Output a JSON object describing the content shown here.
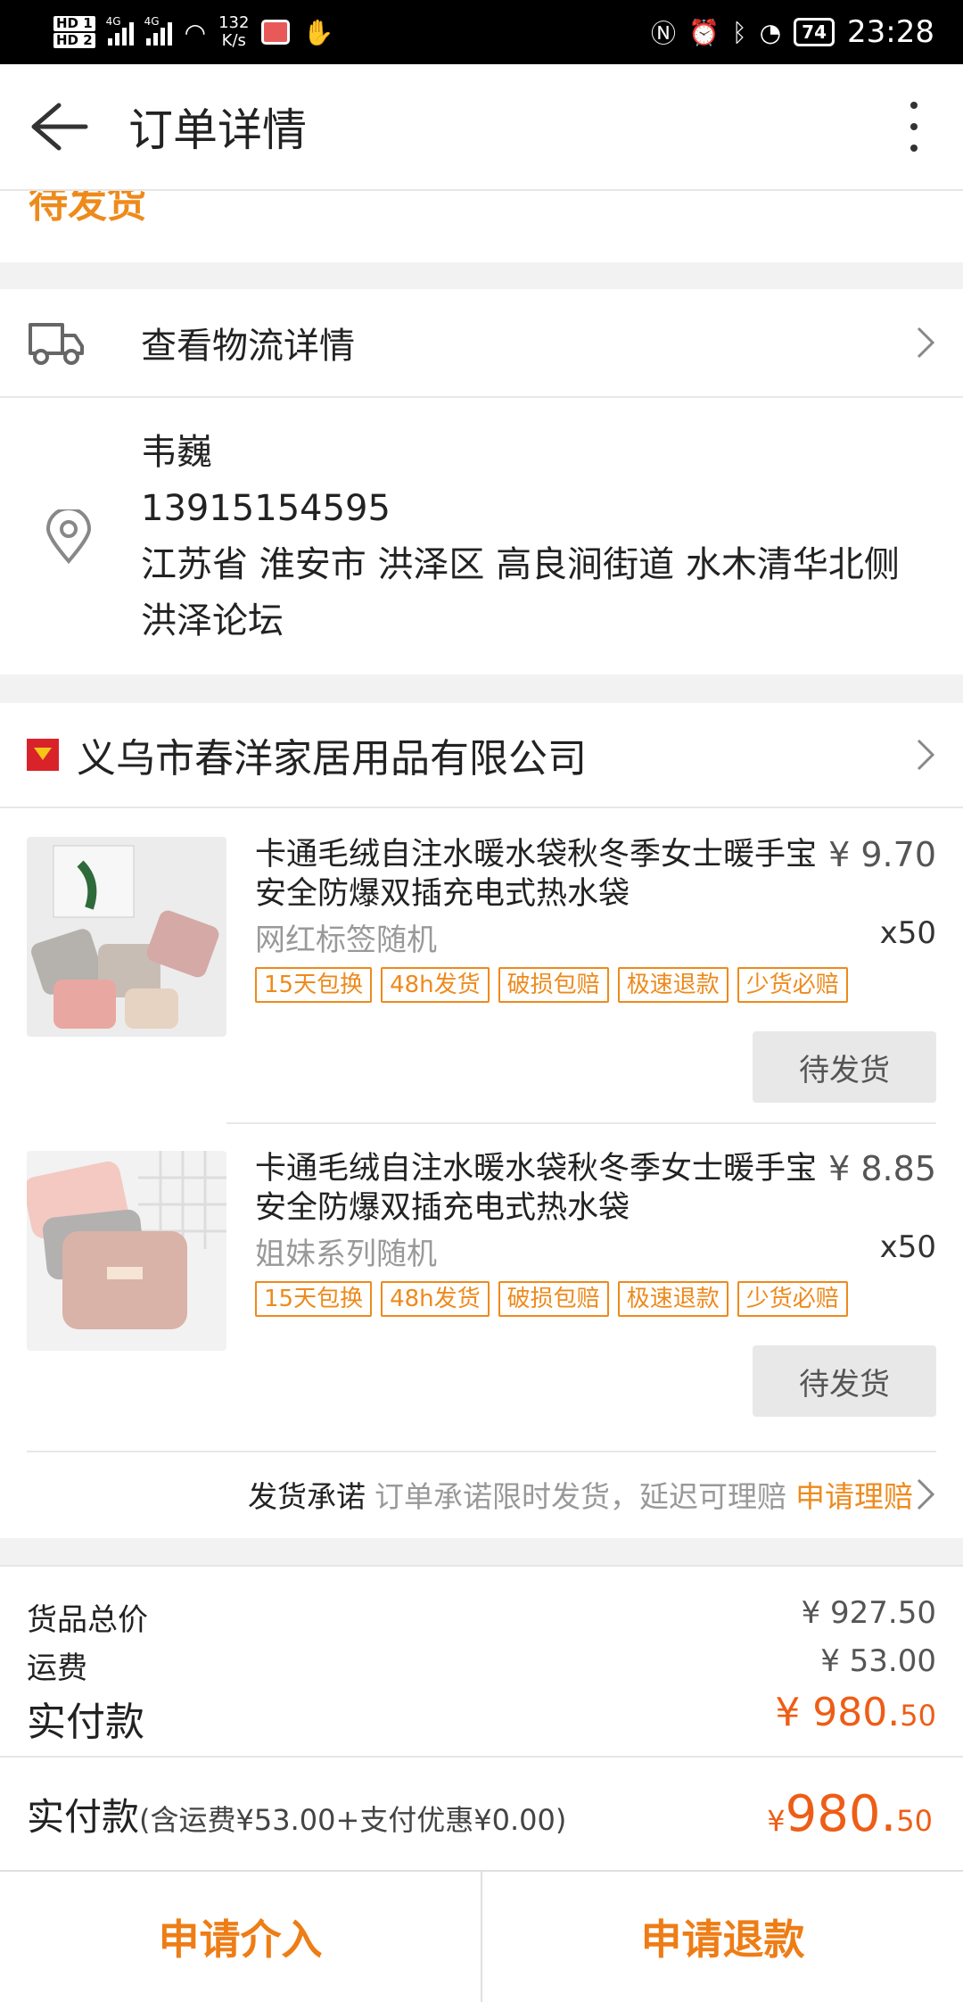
{
  "status_bar": {
    "hd1": "HD 1",
    "hd2": "HD 2",
    "net1": "4G",
    "net2": "4G",
    "speed_value": "132",
    "speed_unit": "K/s",
    "battery": "74",
    "time": "23:28"
  },
  "header": {
    "title": "订单详情"
  },
  "order_status": "待发货",
  "logistics": {
    "label": "查看物流详情"
  },
  "address": {
    "name": "韦巍",
    "phone": "13915154595",
    "line1": "江苏省 淮安市 洪泽区 高良涧街道 水木清华北侧",
    "line2": "洪泽论坛"
  },
  "shop": {
    "name": "义乌市春洋家居用品有限公司"
  },
  "items": [
    {
      "title": "卡通毛绒自注水暖水袋秋冬季女士暖手宝安全防爆双插充电式热水袋",
      "price": "¥ 9.70",
      "spec": "网红标签随机",
      "qty": "x50",
      "tags": [
        "15天包换",
        "48h发货",
        "破损包赔",
        "极速退款",
        "少货必赔"
      ],
      "state": "待发货"
    },
    {
      "title": "卡通毛绒自注水暖水袋秋冬季女士暖手宝安全防爆双插充电式热水袋",
      "price": "¥ 8.85",
      "spec": "姐妹系列随机",
      "qty": "x50",
      "tags": [
        "15天包换",
        "48h发货",
        "破损包赔",
        "极速退款",
        "少货必赔"
      ],
      "state": "待发货"
    }
  ],
  "promise": {
    "label": "发货承诺",
    "desc": "订单承诺限时发货，延迟可理赔",
    "link": "申请理赔"
  },
  "totals": {
    "goods_label": "货品总价",
    "goods_value": "¥ 927.50",
    "shipping_label": "运费",
    "shipping_value": "¥ 53.00",
    "paid_label": "实付款",
    "paid_main": "¥ 980.",
    "paid_cents": "50"
  },
  "summary": {
    "label": "实付款",
    "note": "(含运费¥53.00+支付优惠¥0.00)",
    "currency": "¥",
    "main": "980.",
    "cents": "50"
  },
  "actions": {
    "intervene": "申请介入",
    "refund": "申请退款"
  },
  "colors": {
    "accent": "#ee8a1c",
    "price_red": "#ee5d16",
    "brand_red": "#d9232a"
  }
}
